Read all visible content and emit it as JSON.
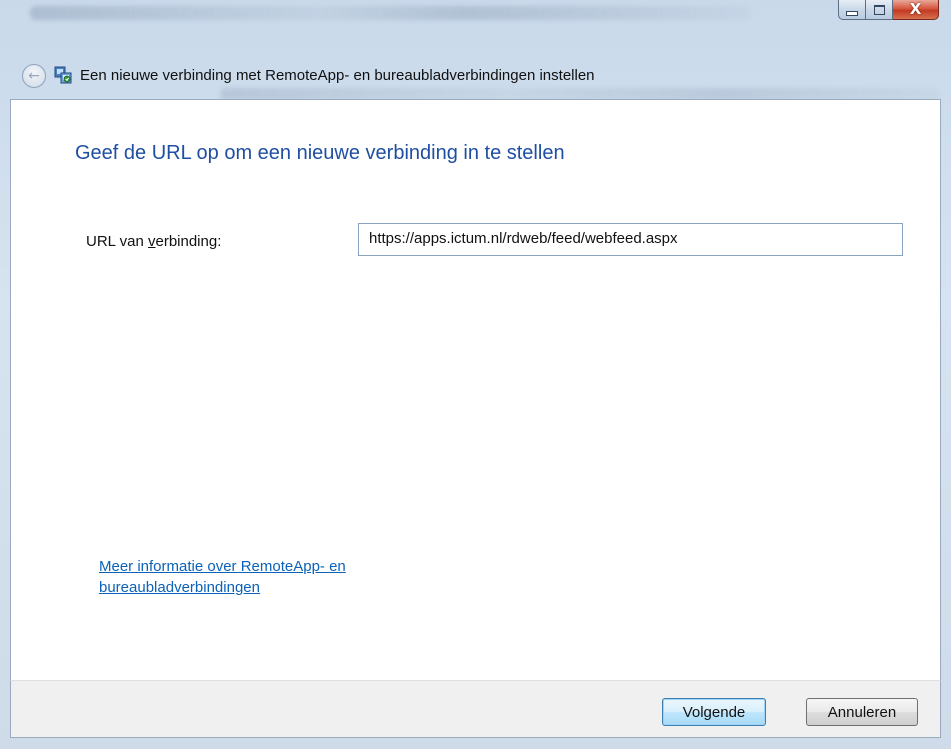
{
  "window": {
    "title": "Een nieuwe verbinding met RemoteApp- en bureaubladverbindingen instellen",
    "caption_buttons": {
      "minimize_icon": "minimize-icon",
      "maximize_icon": "maximize-icon",
      "close_glyph": "X"
    },
    "back_icon": "back-arrow-icon",
    "back_glyph": "←",
    "app_icon": "remoteapp-icon"
  },
  "page": {
    "heading": "Geef de URL op om een nieuwe verbinding in te stellen",
    "url_label_prefix": "URL van ",
    "url_label_accel": "v",
    "url_label_suffix": "erbinding:",
    "url_value": "https://apps.ictum.nl/rdweb/feed/webfeed.aspx",
    "info_link": "Meer informatie over RemoteApp- en bureaubladverbindingen"
  },
  "footer": {
    "next_label": "Volgende",
    "cancel_label": "Annuleren"
  },
  "colors": {
    "heading": "#1f4fa3",
    "link": "#0b62b8",
    "close_button": "#c23a22"
  }
}
